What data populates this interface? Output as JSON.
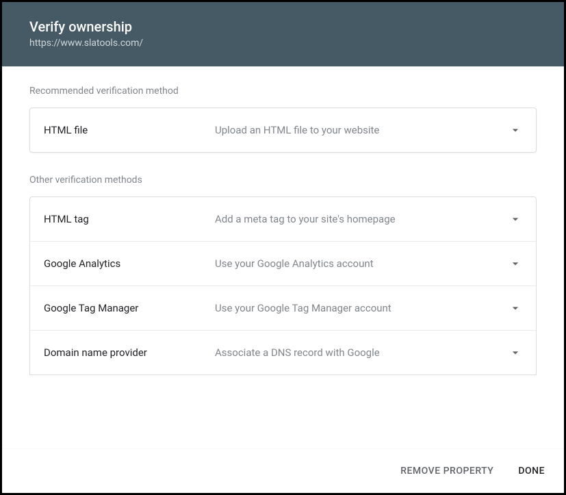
{
  "header": {
    "title": "Verify ownership",
    "subtitle": "https://www.slatools.com/"
  },
  "sections": {
    "recommended_label": "Recommended verification method",
    "other_label": "Other verification methods"
  },
  "recommended": {
    "name": "HTML file",
    "description": "Upload an HTML file to your website"
  },
  "other_methods": [
    {
      "name": "HTML tag",
      "description": "Add a meta tag to your site's homepage"
    },
    {
      "name": "Google Analytics",
      "description": "Use your Google Analytics account"
    },
    {
      "name": "Google Tag Manager",
      "description": "Use your Google Tag Manager account"
    },
    {
      "name": "Domain name provider",
      "description": "Associate a DNS record with Google"
    }
  ],
  "footer": {
    "remove_label": "REMOVE PROPERTY",
    "done_label": "DONE"
  }
}
